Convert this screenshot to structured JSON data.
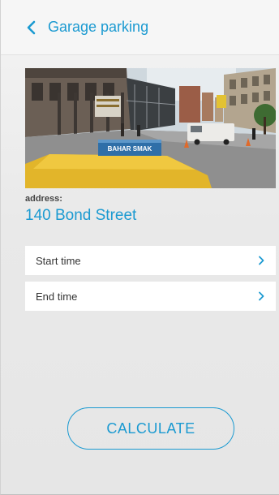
{
  "header": {
    "title": "Garage parking",
    "back_icon": "chevron-left-icon"
  },
  "photo": {
    "sign_text": "BAHAR SMAK"
  },
  "address": {
    "label": "address:",
    "value": "140 Bond Street"
  },
  "fields": [
    {
      "label": "Start time",
      "icon": "chevron-right-icon"
    },
    {
      "label": "End time",
      "icon": "chevron-right-icon"
    }
  ],
  "calculate": {
    "label": "CALCULATE"
  },
  "colors": {
    "accent": "#1b9ad1",
    "background": "#e8e8e8",
    "row_background": "#ffffff"
  }
}
